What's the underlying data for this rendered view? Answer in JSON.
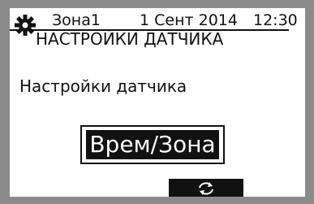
{
  "header": {
    "zone": "Зона1",
    "date": "1 Сент 2014",
    "time": "12:30",
    "icon": "gear-icon"
  },
  "title": "НАСТРОЙКИ ДАТЧИКА",
  "setting": {
    "label": "Настройки датчика",
    "value": "Врем/Зона"
  },
  "function_button": {
    "icon": "cycle-arrows-icon"
  },
  "colors": {
    "background": "#ffffff",
    "foreground": "#111111",
    "bezel": "#8a8a8a"
  }
}
